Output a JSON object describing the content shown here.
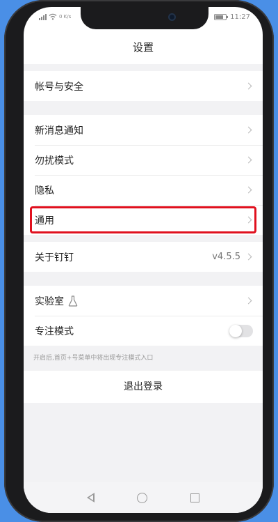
{
  "status": {
    "time": "11:27",
    "speed": "0 K/s"
  },
  "header": {
    "title": "设置"
  },
  "menu": {
    "account": "帐号与安全",
    "notifications": "新消息通知",
    "dnd": "勿扰模式",
    "privacy": "隐私",
    "general": "通用",
    "about": "关于钉钉",
    "about_version": "v4.5.5",
    "lab": "实验室",
    "focus": "专注模式",
    "focus_enabled": false,
    "focus_hint": "开启后,首页+号菜单中将出现专注模式入口",
    "logout": "退出登录"
  },
  "colors": {
    "highlight": "#e0101e",
    "background": "#4a8fe6"
  },
  "icons": [
    "signal-icon",
    "wifi-icon",
    "battery-icon",
    "chevron-right-icon",
    "flask-icon",
    "back-icon",
    "home-icon",
    "recents-icon"
  ]
}
